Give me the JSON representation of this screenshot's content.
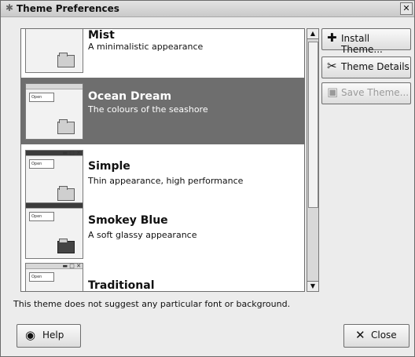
{
  "window": {
    "title": "Theme Preferences",
    "close_glyph": "✕"
  },
  "themes": [
    {
      "name": "Mist",
      "description": "A minimalistic appearance",
      "selected": false
    },
    {
      "name": "Ocean Dream",
      "description": "The colours of the seashore",
      "selected": true
    },
    {
      "name": "Simple",
      "description": "Thin appearance, high performance",
      "selected": false
    },
    {
      "name": "Smokey Blue",
      "description": "A soft glassy appearance",
      "selected": false
    },
    {
      "name": "Traditional",
      "description": "",
      "selected": false
    }
  ],
  "thumbnail": {
    "open_label": "Open",
    "window_buttons": "▬ □ ✕"
  },
  "side_buttons": {
    "install": "Install Theme...",
    "details": "Theme Details",
    "save": "Save Theme..."
  },
  "footer_text": "This theme does not suggest any particular font or background.",
  "bottom_buttons": {
    "help": "Help",
    "close": "Close"
  },
  "colors": {
    "selection": "#6e6e6e",
    "window_bg": "#ececec"
  }
}
